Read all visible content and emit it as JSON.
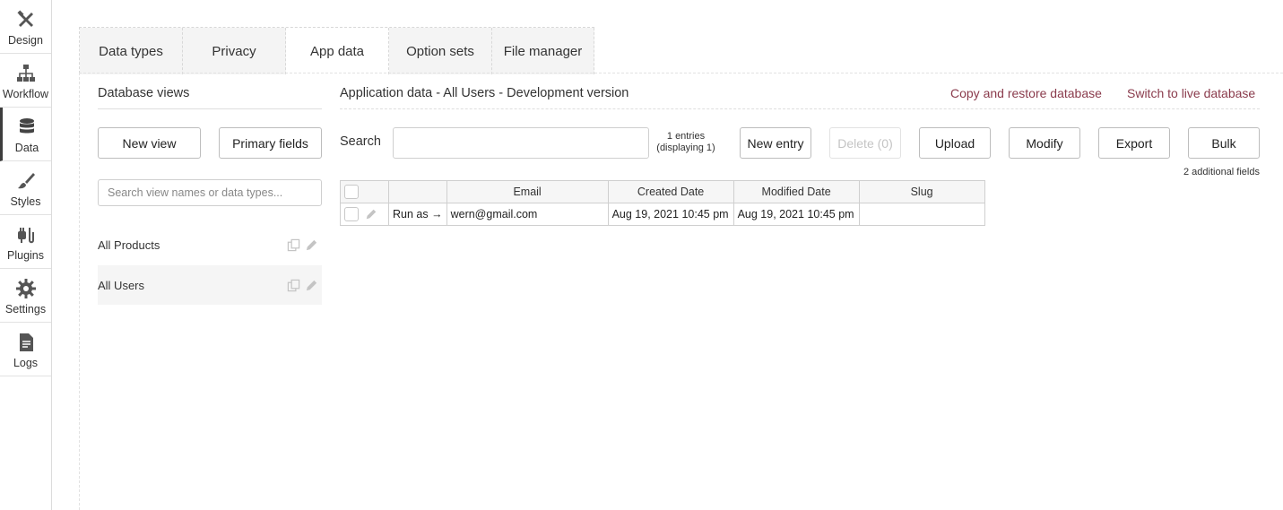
{
  "sidebar": {
    "items": [
      {
        "label": "Design",
        "icon": "design-icon"
      },
      {
        "label": "Workflow",
        "icon": "workflow-icon"
      },
      {
        "label": "Data",
        "icon": "database-icon"
      },
      {
        "label": "Styles",
        "icon": "brush-icon"
      },
      {
        "label": "Plugins",
        "icon": "plug-icon"
      },
      {
        "label": "Settings",
        "icon": "gear-icon"
      },
      {
        "label": "Logs",
        "icon": "document-icon"
      }
    ],
    "active": "Data"
  },
  "tabs": [
    {
      "label": "Data types"
    },
    {
      "label": "Privacy"
    },
    {
      "label": "App data"
    },
    {
      "label": "Option sets"
    },
    {
      "label": "File manager"
    }
  ],
  "active_tab": "App data",
  "views": {
    "title": "Database views",
    "new_view": "New view",
    "primary_fields": "Primary fields",
    "search_placeholder": "Search view names or data types...",
    "items": [
      {
        "name": "All Products"
      },
      {
        "name": "All Users"
      }
    ],
    "selected": "All Users"
  },
  "main": {
    "title": "Application data - All Users - Development version",
    "copy_restore": "Copy and restore database",
    "switch_live": "Switch to live database",
    "search_label": "Search",
    "search_value": "",
    "entries_line1": "1 entries",
    "entries_line2": "(displaying 1)",
    "buttons": {
      "new_entry": "New entry",
      "delete": "Delete (0)",
      "upload": "Upload",
      "modify": "Modify",
      "export": "Export",
      "bulk": "Bulk"
    },
    "additional_fields": "2 additional fields"
  },
  "table": {
    "headers": [
      "",
      "",
      "Email",
      "Created Date",
      "Modified Date",
      "Slug"
    ],
    "rows": [
      {
        "run_as": "Run as →",
        "email": "wern@gmail.com",
        "created": "Aug 19, 2021 10:45 pm",
        "modified": "Aug 19, 2021 10:45 pm",
        "slug": ""
      }
    ]
  },
  "colors": {
    "link": "#8a3b4c",
    "active_border": "#3d3d3d"
  }
}
